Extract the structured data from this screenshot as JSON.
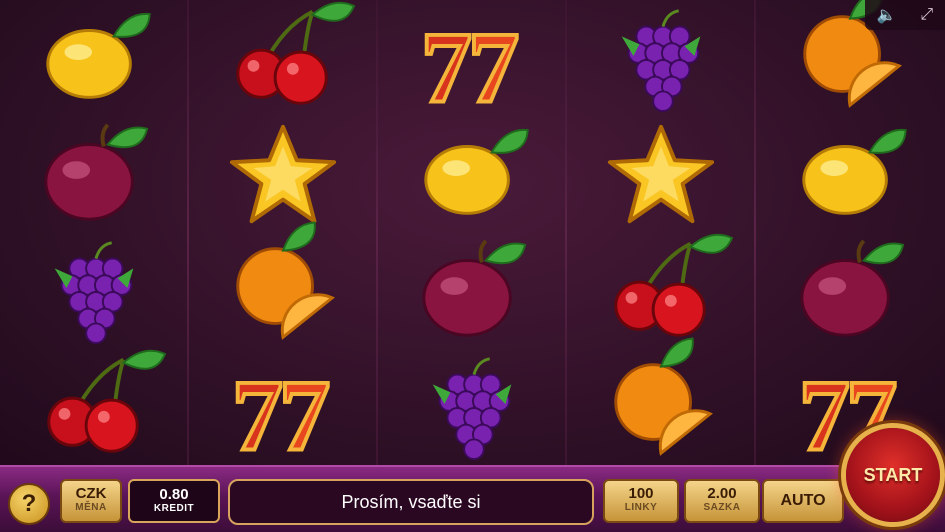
{
  "top_controls": {
    "sound_icon": "speaker-icon",
    "fullscreen_icon": "expand-icon"
  },
  "reels": [
    [
      "lemon",
      "plum",
      "grapes",
      "cherry"
    ],
    [
      "cherry",
      "star",
      "orange",
      "seven"
    ],
    [
      "seven",
      "lemon",
      "plum",
      "grapes"
    ],
    [
      "grapes",
      "star",
      "cherry",
      "orange"
    ],
    [
      "orange",
      "lemon",
      "plum",
      "seven"
    ]
  ],
  "bottom_bar": {
    "help_label": "?",
    "currency_value": "CZK",
    "currency_label": "MĚNA",
    "credit_value": "0.80",
    "credit_label": "KREDIT",
    "message": "Prosím, vsaďte si",
    "lines_value": "100",
    "lines_label": "LINKY",
    "bet_value": "2.00",
    "bet_label": "SAZKA",
    "auto_label": "AUTO",
    "start_label": "START"
  },
  "colors": {
    "accent_gold": "#d7a25e",
    "bar_purple": "#6a1a64",
    "start_red": "#c0181e"
  }
}
